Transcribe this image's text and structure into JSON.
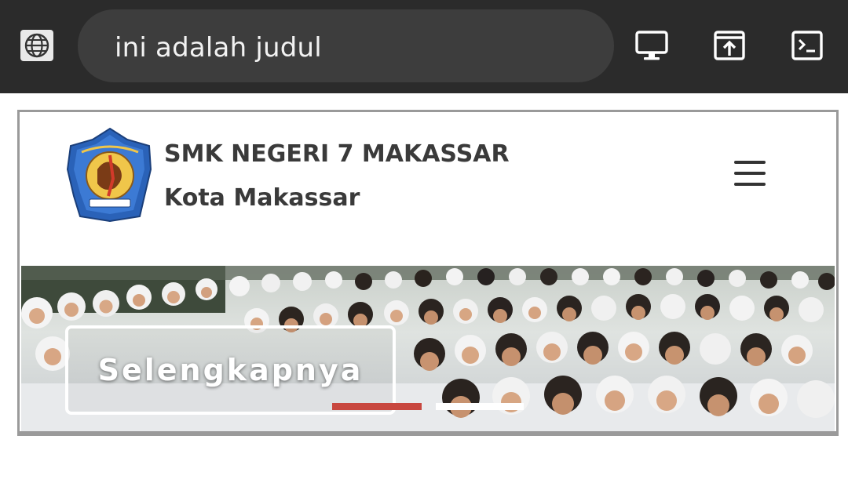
{
  "browser": {
    "address_text": "ini adalah judul",
    "icons": [
      "globe-icon",
      "desktop-icon",
      "open-in-icon",
      "terminal-icon"
    ]
  },
  "site": {
    "school_name": "SMK NEGERI 7 MAKASSAR",
    "city": "Kota Makassar",
    "menu_icon": "hamburger-icon"
  },
  "hero": {
    "cta_label": "Selengkapnya",
    "slides_count": 2,
    "active_slide": 1,
    "indicator_active_color": "#c8473f",
    "indicator_inactive_color": "#ffffff"
  },
  "colors": {
    "topbar": "#2b2b2b",
    "urlbox": "#3d3d3d",
    "heading_text": "#3a3a3a"
  }
}
